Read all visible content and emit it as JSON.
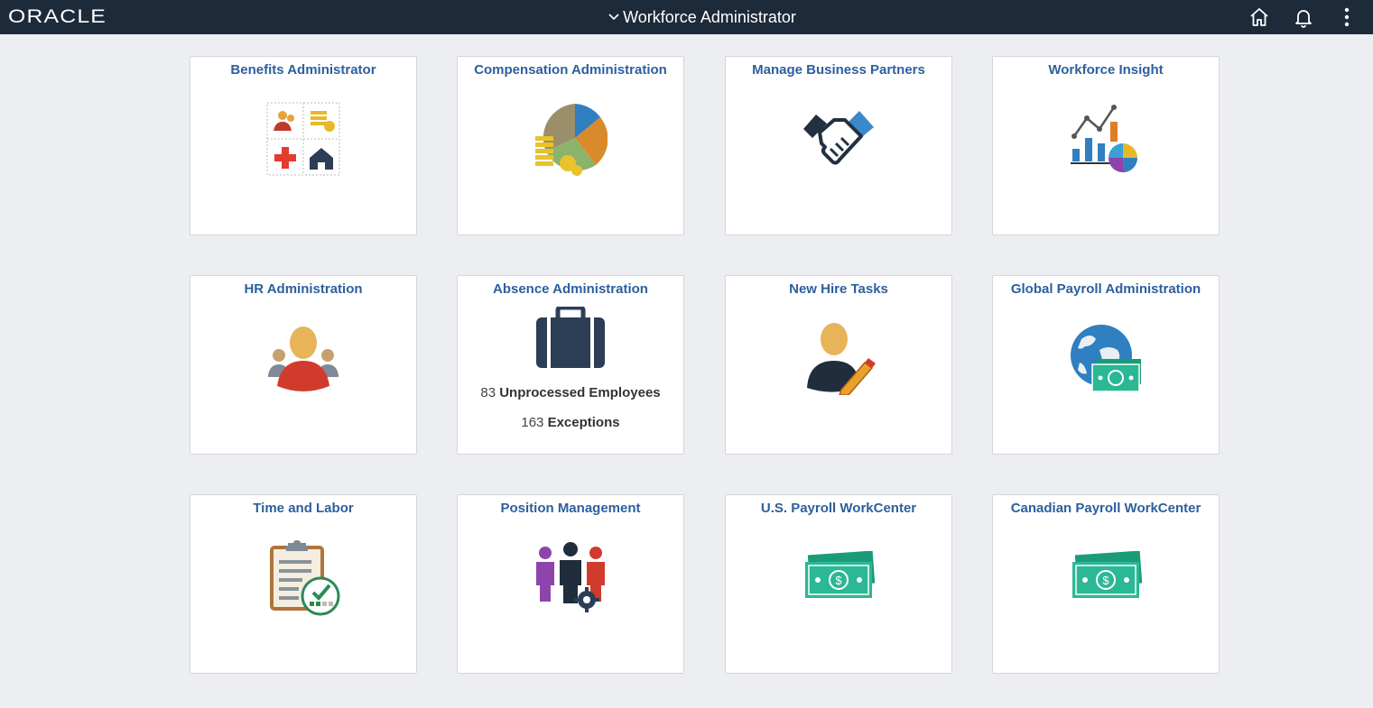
{
  "header": {
    "logo": "ORACLE",
    "title": "Workforce Administrator",
    "icons": [
      "home-icon",
      "bell-icon",
      "more-vertical-icon"
    ]
  },
  "tiles": [
    {
      "title": "Benefits Administrator",
      "icon": "benefits-icon"
    },
    {
      "title": "Compensation Administration",
      "icon": "compensation-icon"
    },
    {
      "title": "Manage Business Partners",
      "icon": "handshake-icon"
    },
    {
      "title": "Workforce Insight",
      "icon": "analytics-icon"
    },
    {
      "title": "HR Administration",
      "icon": "people-icon"
    },
    {
      "title": "Absence Administration",
      "icon": "briefcase-icon",
      "metrics": [
        {
          "value": "83",
          "label": "Unprocessed Employees"
        },
        {
          "value": "163",
          "label": "Exceptions"
        }
      ]
    },
    {
      "title": "New Hire Tasks",
      "icon": "new-hire-icon"
    },
    {
      "title": "Global Payroll Administration",
      "icon": "global-payroll-icon"
    },
    {
      "title": "Time and Labor",
      "icon": "clipboard-icon"
    },
    {
      "title": "Position Management",
      "icon": "position-icon"
    },
    {
      "title": "U.S. Payroll WorkCenter",
      "icon": "money-icon"
    },
    {
      "title": "Canadian Payroll WorkCenter",
      "icon": "money-icon"
    }
  ],
  "colors": {
    "topbar": "#1d2a3a",
    "tile_title": "#2c5f9e",
    "background": "#eceef1"
  }
}
